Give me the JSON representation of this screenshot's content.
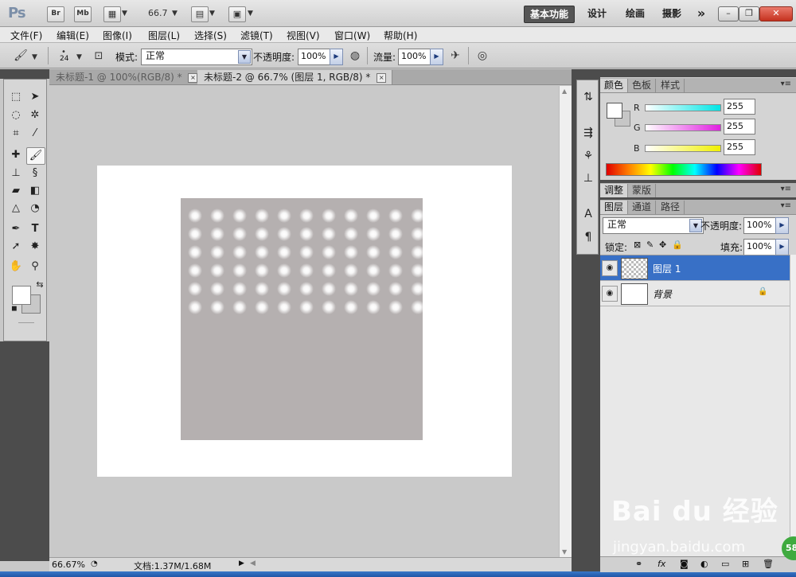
{
  "app": {
    "logo": "Ps",
    "bridge_label": "Br",
    "minibridge_label": "Mb",
    "zoom_display": "66.7",
    "workspaces": [
      "基本功能",
      "设计",
      "绘画",
      "摄影"
    ],
    "more_label": "»",
    "window_controls": [
      "–",
      "❐",
      "✕"
    ]
  },
  "menu": [
    "文件(F)",
    "编辑(E)",
    "图像(I)",
    "图层(L)",
    "选择(S)",
    "滤镜(T)",
    "视图(V)",
    "窗口(W)",
    "帮助(H)"
  ],
  "options": {
    "brush_size": "24",
    "mode_label": "模式:",
    "mode_value": "正常",
    "opacity_label": "不透明度:",
    "opacity_value": "100%",
    "flow_label": "流量:",
    "flow_value": "100%"
  },
  "tabs": [
    {
      "title": "未标题-1 @ 100%(RGB/8) *",
      "active": false
    },
    {
      "title": "未标题-2 @ 66.7% (图层 1, RGB/8) *",
      "active": true
    }
  ],
  "tab_close": "×",
  "status": {
    "zoom": "66.67%",
    "doc_info": "文档:1.37M/1.68M"
  },
  "color_panel": {
    "tabs": [
      "颜色",
      "色板",
      "样式"
    ],
    "channels": [
      {
        "label": "R",
        "value": "255",
        "from": "#ffffff",
        "to": "#00e5e5"
      },
      {
        "label": "G",
        "value": "255",
        "from": "#ffffff",
        "to": "#e020e0"
      },
      {
        "label": "B",
        "value": "255",
        "from": "#ffffff",
        "to": "#f0f000"
      }
    ]
  },
  "adjust_panel": {
    "tabs": [
      "调整",
      "蒙版"
    ]
  },
  "layers_panel": {
    "tabs": [
      "图层",
      "通道",
      "路径"
    ],
    "blend_mode": "正常",
    "opacity_label": "不透明度:",
    "opacity_value": "100%",
    "lock_label": "锁定:",
    "fill_label": "填充:",
    "fill_value": "100%",
    "layers": [
      {
        "name": "图层 1",
        "selected": true
      },
      {
        "name": "背景",
        "selected": false
      }
    ],
    "footer_icons": [
      "link-icon",
      "fx-icon",
      "mask-icon",
      "adjustment-icon",
      "group-icon",
      "new-layer-icon",
      "trash-icon"
    ]
  },
  "canvas": {
    "page_color": "#ffffff",
    "layer_color": "#b5b0b0",
    "dot_rows": 6,
    "dot_cols": 11
  },
  "watermark": {
    "brand": "Bai du 经验",
    "url": "jingyan.baidu.com"
  },
  "badge": "58"
}
